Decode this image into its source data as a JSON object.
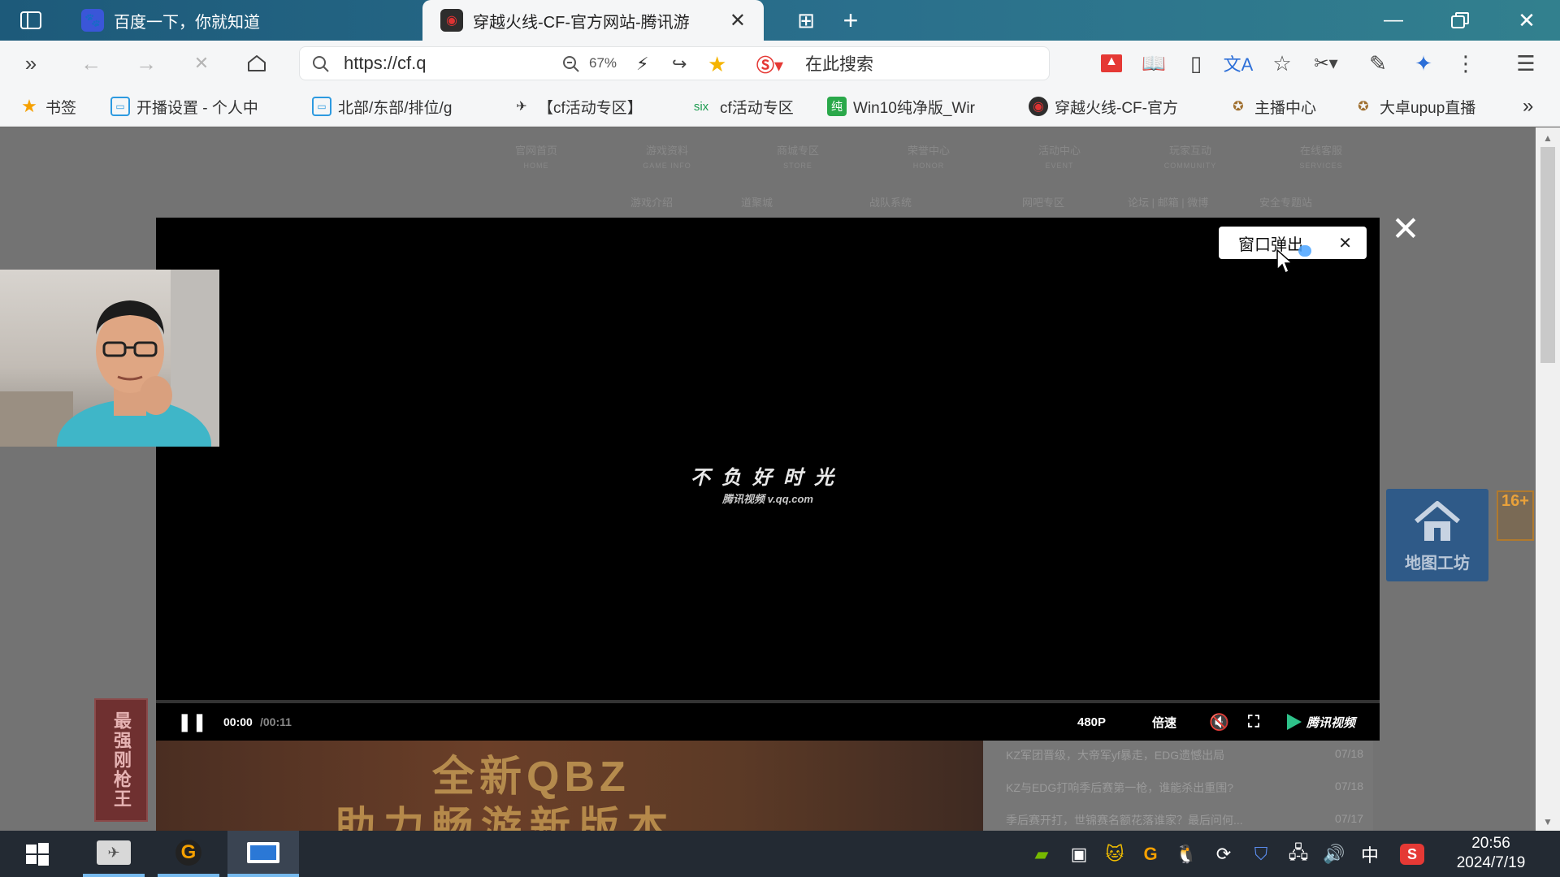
{
  "browser": {
    "tabs": [
      {
        "title": "百度一下，你就知道",
        "active": false,
        "icon": "baidu-paw-icon"
      },
      {
        "title": "穿越火线-CF-官方网站-腾讯游",
        "active": true,
        "icon": "cf-logo-icon"
      }
    ],
    "address": {
      "url": "https://cf.q",
      "zoom": "67%",
      "search_placeholder": "在此搜索"
    },
    "bookmarks": [
      {
        "label": "书签",
        "icon": "star-icon"
      },
      {
        "label": "开播设置 - 个人中",
        "icon": "bilibili-icon"
      },
      {
        "label": "北部/东部/排位/g",
        "icon": "bilibili-icon"
      },
      {
        "label": "【cf活动专区】",
        "icon": "cf-wing-icon"
      },
      {
        "label": "cf活动专区",
        "icon": "six-icon",
        "prefix": "six"
      },
      {
        "label": "Win10纯净版_Wir",
        "icon": "chun-icon",
        "prefix": "纯"
      },
      {
        "label": "穿越火线-CF-官方",
        "icon": "cf-logo-icon"
      },
      {
        "label": "主播中心",
        "icon": "streamer-icon"
      },
      {
        "label": "大卓upup直播",
        "icon": "streamer-icon"
      }
    ]
  },
  "site_nav": [
    {
      "label": "官网首页",
      "sub": "HOME"
    },
    {
      "label": "游戏资料",
      "sub": "GAME INFO"
    },
    {
      "label": "商城专区",
      "sub": "STORE"
    },
    {
      "label": "荣誉中心",
      "sub": "HONOR"
    },
    {
      "label": "活动中心",
      "sub": "EVENT"
    },
    {
      "label": "玩家互动",
      "sub": "COMMUNITY"
    },
    {
      "label": "在线客服",
      "sub": "SERVICES"
    }
  ],
  "site_subnav": [
    "游戏介绍",
    "道聚城",
    "战队系统",
    "网吧专区",
    "论坛 | 邮箱 | 微博",
    "安全专题站"
  ],
  "video": {
    "slogan": "不负好时光",
    "site": "腾讯视频 v.qq.com",
    "time_current": "00:00",
    "time_total": "/00:11",
    "quality": "480P",
    "speed": "倍速",
    "brand": "腾讯视频",
    "popup_label": "窗口弹出"
  },
  "widgets": {
    "map_label": "地图工坊",
    "badge": "16+",
    "side_banner": "最强刚枪王",
    "promo_line1": "全新QBZ",
    "promo_line2": "助力畅游新版本"
  },
  "news": [
    {
      "title": "KZ军团晋级，大帝军yf暴走，EDG遗憾出局",
      "date": "07/18"
    },
    {
      "title": "KZ与EDG打响季后赛第一枪，谁能杀出重围?",
      "date": "07/18"
    },
    {
      "title": "季后赛开打，世锦赛名额花落谁家？最后问何...",
      "date": "07/17"
    }
  ],
  "taskbar": {
    "time": "20:56",
    "date": "2024/7/19",
    "ime": "中"
  },
  "colors": {
    "tab_gradient_start": "#1d5a7a",
    "tab_gradient_end": "#32808e",
    "video_bg": "#000000",
    "map_widget": "#2f5a88",
    "taskbar": "#232a33"
  }
}
